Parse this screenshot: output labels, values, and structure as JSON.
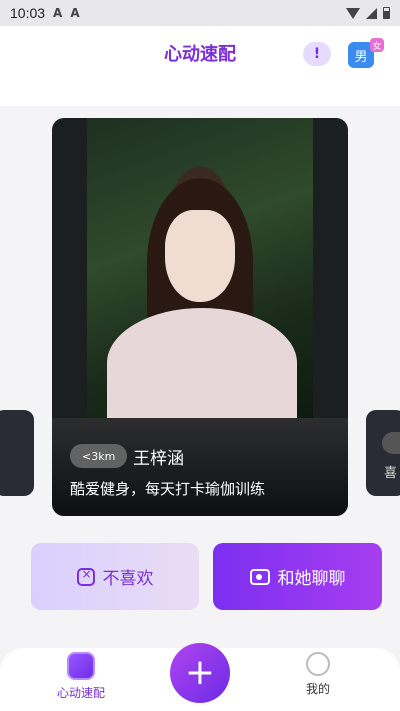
{
  "status": {
    "time": "10:03",
    "icons": [
      "A",
      "A"
    ]
  },
  "header": {
    "title": "心动速配",
    "report_icon": "!",
    "gender": {
      "male": "男",
      "female": "女"
    }
  },
  "card": {
    "distance": "<3km",
    "name": "王梓涵",
    "bio": "酷爱健身，每天打卡瑜伽训练"
  },
  "side_right": {
    "hint": "喜"
  },
  "actions": {
    "dislike": "不喜欢",
    "chat": "和她聊聊"
  },
  "tabs": {
    "match": "心动速配",
    "mine": "我的",
    "plus": "+"
  }
}
